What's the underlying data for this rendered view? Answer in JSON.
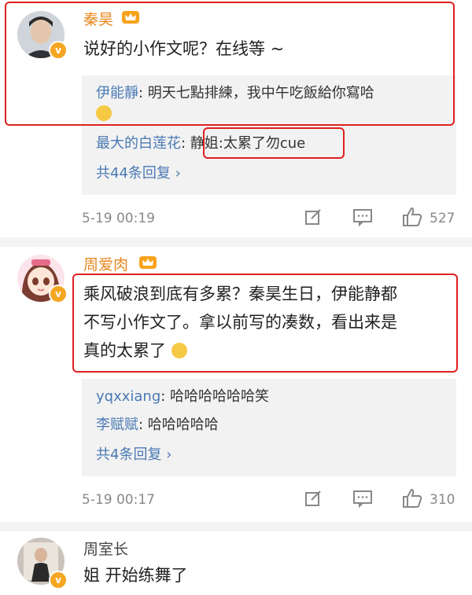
{
  "comments": [
    {
      "username": "秦昊",
      "text": "说好的小作文呢？在线等 ~",
      "replies": [
        {
          "name": "伊能靜",
          "text": "明天七點排練，我中午吃飯給你寫哈"
        },
        {
          "name": "最大的白莲花",
          "text": "静姐:太累了勿cue"
        }
      ],
      "more_replies": "共44条回复",
      "time": "5-19 00:19",
      "likes": "527"
    },
    {
      "username": "周爱肉",
      "text_line1": "乘风破浪到底有多累？秦昊生日，伊能静都",
      "text_line2": "不写小作文了。拿以前写的凑数，看出来是",
      "text_line3": "真的太累了",
      "replies": [
        {
          "name": "yqxxiang",
          "text": "哈哈哈哈哈哈笑"
        },
        {
          "name": "李赋赋",
          "text": "哈哈哈哈哈"
        }
      ],
      "more_replies": "共4条回复",
      "time": "5-19 00:17",
      "likes": "310"
    },
    {
      "username": "周室长",
      "text": "姐 开始练舞了"
    }
  ],
  "colors": {
    "highlight_box": "#e02020",
    "username_orange": "#e8871e",
    "link_blue": "#4a79b4"
  }
}
